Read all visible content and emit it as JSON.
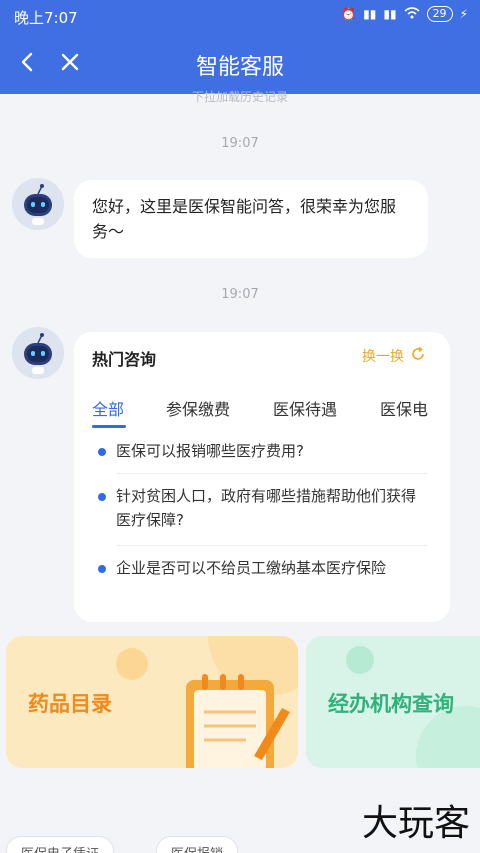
{
  "statusbar": {
    "time": "晚上7:07",
    "battery": "29"
  },
  "header": {
    "title": "智能客服"
  },
  "chat": {
    "pull_hint": "下拉加载历史记录",
    "timestamp1": "19:07",
    "greeting": "您好，这里是医保智能问答，很荣幸为您服务～",
    "timestamp2": "19:07"
  },
  "hot": {
    "title": "热门咨询",
    "refresh_label": "换一换",
    "tabs": [
      "全部",
      "参保缴费",
      "医保待遇",
      "医保电"
    ],
    "questions": [
      "医保可以报销哪些医疗费用?",
      "针对贫困人口，政府有哪些措施帮助他们获得医疗保障?",
      "企业是否可以不给员工缴纳基本医疗保险"
    ]
  },
  "promos": {
    "drug": "药品目录",
    "agency": "经办机构查询"
  },
  "bottom_chips": [
    "医保电子凭证",
    "医保报销"
  ],
  "watermark": "大玩客",
  "colors": {
    "primary": "#3f6fe3",
    "accent": "#f5a623",
    "tab_active": "#2f6be6"
  }
}
